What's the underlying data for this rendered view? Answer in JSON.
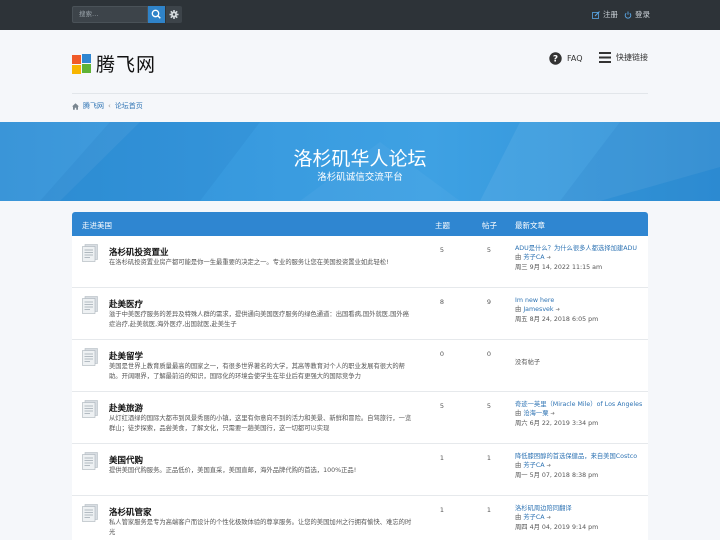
{
  "topbar": {
    "search_placeholder": "搜索…",
    "register": "注册",
    "login": "登录"
  },
  "header": {
    "site_name": "腾飞网",
    "faq": "FAQ",
    "quick_links": "快捷链接"
  },
  "breadcrumb": {
    "home": "腾飞网",
    "index": "论坛首页"
  },
  "banner": {
    "title": "洛杉矶华人论坛",
    "subtitle": "洛杉矶诚信交流平台"
  },
  "forum": {
    "category": "走进美国",
    "col_topics": "主题",
    "col_posts": "帖子",
    "col_last": "最新文章",
    "rows": [
      {
        "title": "洛杉矶投资置业",
        "desc": "在洛杉矶投资置业房产都可能是你一生最重要的决定之一。专业的服务让您在美国投资置业如此轻松!",
        "topics": "5",
        "posts": "5",
        "last_title": "ADU是什么？为什么很多人都选择加建ADU",
        "last_by": "由",
        "last_user": "芳子CA",
        "last_date": "周三 9月 14, 2022 11:15 am"
      },
      {
        "title": "赴美医疗",
        "desc": "滋于中美医疗服务的差异及特殊人群的需求，提供通向美国医疗服务的绿色通道：出国看病,国外就医,国外癌症治疗,赴美就医,海外医疗,出国就医,赴美生子",
        "topics": "8",
        "posts": "9",
        "last_title": "Im new here",
        "last_by": "由",
        "last_user": "Jamesvek",
        "last_date": "周五 8月 24, 2018 6:05 pm"
      },
      {
        "title": "赴美留学",
        "desc": "美国是世界上教育质量最高的国家之一，有很多世界著名的大学，其高等教育对个人的职业发展有很大的帮助。开阔眼界，了解最前沿的知识，国际化的环境会使学生在毕业后有更强大的国际竞争力",
        "topics": "0",
        "posts": "0",
        "last_title": "没有帖子",
        "last_by": "",
        "last_user": "",
        "last_date": ""
      },
      {
        "title": "赴美旅游",
        "desc": "从灯红酒绿的国际大都市到风景秀丽的小镇，这里有你意向不到的活力和美景、新鲜和冒险。自驾旅行，一览群山；徒步探索，品尝美食，了解文化，只需要一趟美国行，这一切都可以实现",
        "topics": "5",
        "posts": "5",
        "last_title": "奇迹一英里（Miracle Mile）of Los Angeles",
        "last_by": "由",
        "last_user": "沧海一粟",
        "last_date": "周六 6月 22, 2019 3:34 pm"
      },
      {
        "title": "美国代购",
        "desc": "提供美国代购服务。正品低价，美国直采，美国直邮，海外品牌代购的首选，100%正品!",
        "topics": "1",
        "posts": "1",
        "last_title": "降低膝困醇的首选保健品，来自美国Costco",
        "last_by": "由",
        "last_user": "芳子CA",
        "last_date": "周一 5月 07, 2018 8:38 pm"
      },
      {
        "title": "洛杉矶管家",
        "desc": "私人管家服务是专为高端客户而设计的个性化极致体验的尊享服务。让您的美国加州之行拥有愉快、难忘的时光",
        "topics": "1",
        "posts": "1",
        "last_title": "洛杉矶周边陪同翻译",
        "last_by": "由",
        "last_user": "芳子CA",
        "last_date": "周四 4月 04, 2019 9:14 pm"
      }
    ]
  }
}
